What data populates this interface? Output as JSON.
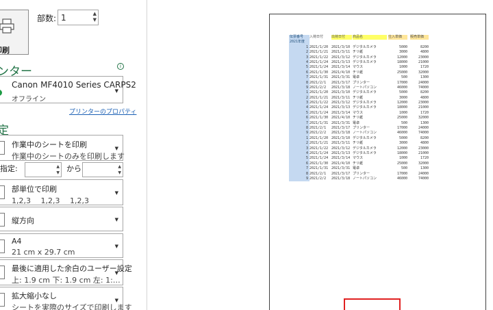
{
  "print": {
    "button_label": "印刷"
  },
  "copies": {
    "label": "部数:",
    "value": "1"
  },
  "printer": {
    "section_title": "ンター",
    "name": "Canon MF4010 Series CARPS2",
    "status": "オフライン",
    "properties_link": "プリンターのプロパティ"
  },
  "settings": {
    "section_title": "定",
    "scope": {
      "line1": "作業中のシートを印刷",
      "line2": "作業中のシートのみを印刷します"
    },
    "pages": {
      "label": "指定:",
      "to_label": "から",
      "from_value": "",
      "to_value": ""
    },
    "collate": {
      "line1": "部単位で印刷",
      "line2": "1,2,3　 1,2,3　 1,2,3"
    },
    "orientation": {
      "line1": "縦方向"
    },
    "paper": {
      "line1": "A4",
      "line2": "21 cm x 29.7 cm"
    },
    "margins": {
      "line1": "最後に適用した余白のユーザー設定",
      "line2": "上: 1.9 cm 下: 1.9 cm 左: 1:…"
    },
    "scaling": {
      "line1": "拡大縮小なし",
      "line2": "シートを実際のサイズで印刷します"
    }
  },
  "preview": {
    "headers": [
      "伝票番号",
      "入荷日付",
      "出荷日付",
      "商品名",
      "仕入単価",
      "販売単価"
    ],
    "year_label": "2021年度",
    "rows": [
      [
        "1",
        "2021/1/20",
        "2021/3/10",
        "デジタルカメラ",
        "5000",
        "8200"
      ],
      [
        "2",
        "2021/1/21",
        "2021/3/11",
        "チリ紙",
        "3000",
        "4800"
      ],
      [
        "3",
        "2021/1/22",
        "2021/3/12",
        "デジタルカメラ",
        "12000",
        "23000"
      ],
      [
        "4",
        "2021/1/24",
        "2021/3/13",
        "デジタルカメラ",
        "18000",
        "21000"
      ],
      [
        "5",
        "2021/1/24",
        "2021/3/14",
        "マウス",
        "1000",
        "1720"
      ],
      [
        "6",
        "2021/1/30",
        "2021/4/10",
        "チリ紙",
        "25000",
        "32000"
      ],
      [
        "7",
        "2021/1/31",
        "2021/3/31",
        "電卓",
        "500",
        "1300"
      ],
      [
        "8",
        "2021/2/1",
        "2021/3/17",
        "プリンター",
        "17000",
        "24000"
      ],
      [
        "9",
        "2021/2/2",
        "2021/3/18",
        "ノートパソコン",
        "46000",
        "74000"
      ],
      [
        "1",
        "2021/1/20",
        "2021/3/10",
        "デジタルカメラ",
        "5000",
        "8200"
      ],
      [
        "2",
        "2021/1/21",
        "2021/3/11",
        "チリ紙",
        "3000",
        "4800"
      ],
      [
        "3",
        "2021/1/22",
        "2021/3/12",
        "デジタルカメラ",
        "12000",
        "23000"
      ],
      [
        "4",
        "2021/1/24",
        "2021/3/13",
        "デジタルカメラ",
        "18000",
        "21000"
      ],
      [
        "5",
        "2021/1/24",
        "2021/3/14",
        "マウス",
        "1000",
        "1720"
      ],
      [
        "6",
        "2021/1/30",
        "2021/4/10",
        "チリ紙",
        "25000",
        "32000"
      ],
      [
        "7",
        "2021/1/31",
        "2021/3/31",
        "電卓",
        "500",
        "1300"
      ],
      [
        "8",
        "2021/2/1",
        "2021/3/17",
        "プリンター",
        "17000",
        "24000"
      ],
      [
        "9",
        "2021/2/2",
        "2021/3/18",
        "ノートパソコン",
        "46000",
        "74000"
      ],
      [
        "1",
        "2021/1/20",
        "2021/3/10",
        "デジタルカメラ",
        "5000",
        "8200"
      ],
      [
        "2",
        "2021/1/21",
        "2021/3/11",
        "チリ紙",
        "3000",
        "4800"
      ],
      [
        "3",
        "2021/1/22",
        "2021/3/12",
        "デジタルカメラ",
        "12000",
        "23000"
      ],
      [
        "4",
        "2021/1/24",
        "2021/3/13",
        "デジタルカメラ",
        "18000",
        "21000"
      ],
      [
        "5",
        "2021/1/24",
        "2021/3/14",
        "マウス",
        "1000",
        "1720"
      ],
      [
        "6",
        "2021/1/30",
        "2021/4/10",
        "チリ紙",
        "25000",
        "32000"
      ],
      [
        "7",
        "2021/1/31",
        "2021/3/31",
        "電卓",
        "500",
        "1300"
      ],
      [
        "8",
        "2021/2/1",
        "2021/3/17",
        "プリンター",
        "17000",
        "24000"
      ],
      [
        "9",
        "2021/2/2",
        "2021/3/18",
        "ノートパソコン",
        "46000",
        "74000"
      ]
    ]
  },
  "colors": {
    "accent": "#217346",
    "link": "#1a5fb4",
    "highlight_box": "#e02020"
  }
}
